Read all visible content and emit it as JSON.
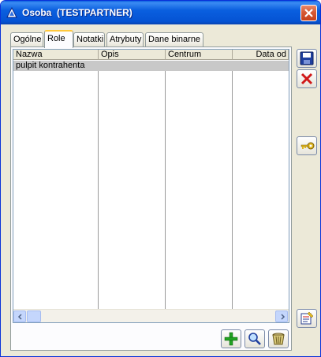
{
  "window": {
    "title": "Osoba  (TESTPARTNER)",
    "icons": {
      "app": "app-logo-icon",
      "close": "close-icon"
    }
  },
  "tabs": [
    {
      "label": "Ogólne",
      "active": false
    },
    {
      "label": "Role",
      "active": true
    },
    {
      "label": "Notatki",
      "active": false
    },
    {
      "label": "Atrybuty",
      "active": false
    },
    {
      "label": "Dane binarne",
      "active": false
    }
  ],
  "grid": {
    "columns": [
      "Nazwa",
      "Opis",
      "Centrum",
      "Data od"
    ],
    "rows": [
      {
        "nazwa": "pulpit kontrahenta",
        "opis": "",
        "centrum": "",
        "data_od": ""
      }
    ]
  },
  "side_toolbar": {
    "icons": [
      "save-icon",
      "cancel-icon",
      "keys-icon",
      "notes-icon"
    ]
  },
  "bottom_toolbar": {
    "icons": [
      "add-icon",
      "search-icon",
      "delete-basket-icon"
    ]
  },
  "colors": {
    "titlebar": "#0a5fdf",
    "window_bg": "#ece9d8",
    "selected_row": "#c8c8c8",
    "active_tab_accent": "#ffc83c"
  }
}
